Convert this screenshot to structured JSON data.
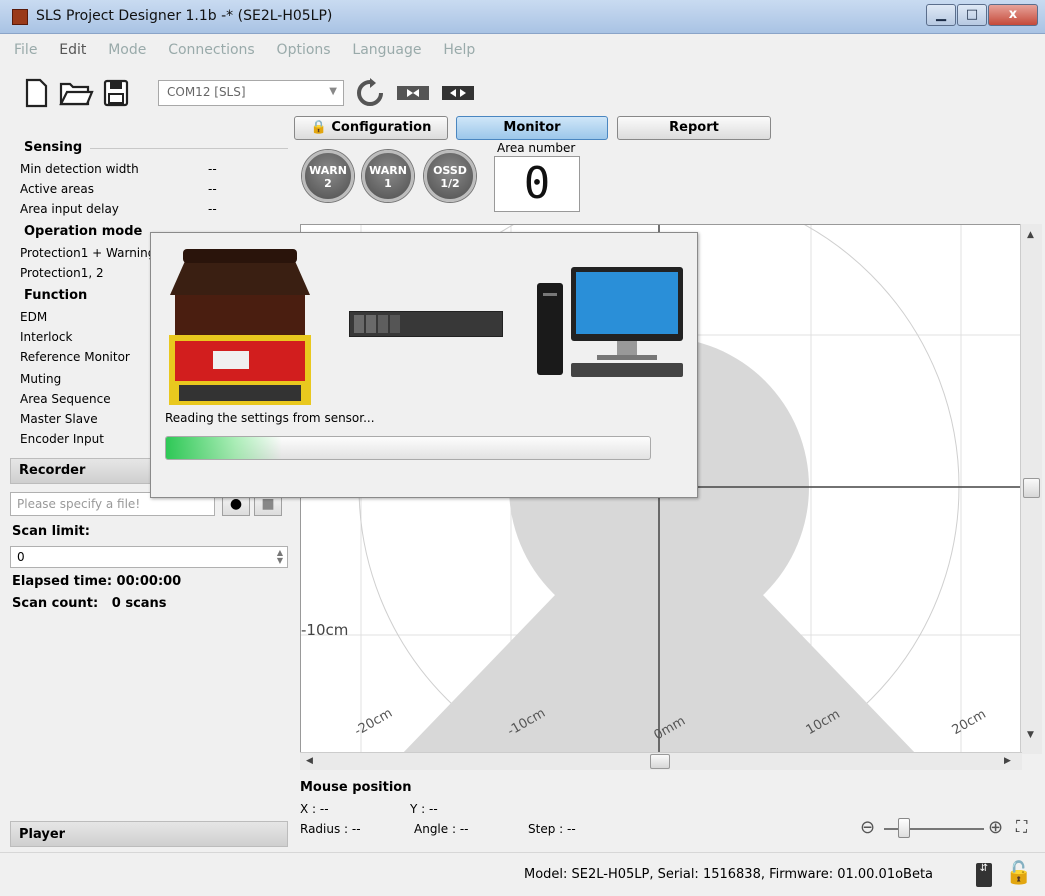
{
  "window": {
    "title": "SLS Project Designer 1.1b -* (SE2L-H05LP)",
    "min_label": "▁",
    "max_label": "□",
    "close_label": "x"
  },
  "menu": [
    {
      "label": "File",
      "enabled": false
    },
    {
      "label": "Edit",
      "enabled": true
    },
    {
      "label": "Mode",
      "enabled": false
    },
    {
      "label": "Connections",
      "enabled": false
    },
    {
      "label": "Options",
      "enabled": false
    },
    {
      "label": "Language",
      "enabled": false
    },
    {
      "label": "Help",
      "enabled": false
    }
  ],
  "toolbar": {
    "com_port": "COM12 [SLS]"
  },
  "modes": {
    "configuration": "Configuration",
    "monitor": "Monitor",
    "report": "Report"
  },
  "left": {
    "sensing_head": "Sensing",
    "sensing": [
      {
        "label": "Min detection width",
        "value": "--"
      },
      {
        "label": "Active areas",
        "value": "--"
      },
      {
        "label": "Area input delay",
        "value": "--"
      }
    ],
    "opmode_head": "Operation mode",
    "opmode": [
      "Protection1 + Warning",
      "Protection1, 2"
    ],
    "function_head": "Function",
    "functions": [
      "EDM",
      "Interlock",
      "Reference Monitor",
      "Muting",
      "Area Sequence",
      "Master Slave",
      "Encoder Input"
    ]
  },
  "recorder": {
    "head": "Recorder",
    "file_placeholder": "Please specify a file!",
    "scan_limit_label": "Scan limit:",
    "scan_limit_value": "0",
    "elapsed": "Elapsed time: 00:00:00",
    "scan_count": "Scan count:   0 scans"
  },
  "player": {
    "head": "Player"
  },
  "lamps": {
    "warn2": [
      "WARN",
      "2"
    ],
    "warn1": [
      "WARN",
      "1"
    ],
    "ossd": [
      "OSSD",
      "1/2"
    ]
  },
  "area": {
    "label": "Area number",
    "value": "0"
  },
  "plot": {
    "y_label": "-10cm",
    "x_labels": [
      "-20cm",
      "-10cm",
      "0mm",
      "10cm",
      "20cm"
    ]
  },
  "mouse": {
    "head": "Mouse position",
    "x": "X : --",
    "y": "Y : --",
    "radius": "Radius : --",
    "angle": "Angle : --",
    "step": "Step : --"
  },
  "status": {
    "text": "Model: SE2L-H05LP, Serial: 1516838, Firmware: 01.00.01oBeta"
  },
  "dialog": {
    "message": "Reading the settings from sensor...",
    "progress": 0.24
  },
  "colors": {
    "accent": "#9cc7ea",
    "progress": "#2ec856",
    "plot_area": "#d8d8d8"
  }
}
